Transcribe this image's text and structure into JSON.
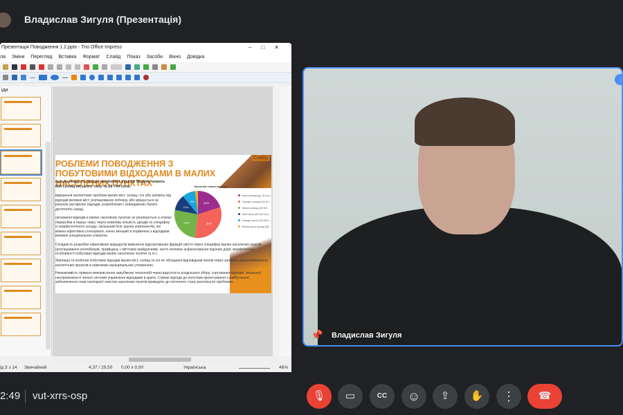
{
  "meeting": {
    "presenter_title": "Владислав Зигуля (Презентація)",
    "time": "2:49",
    "code": "vut-xrrs-osp"
  },
  "window": {
    "title": "Презентація Поводження 1.2.pptx - Trio Office Impress",
    "menu": [
      "ла",
      "Зміни",
      "Перегляд",
      "Вставка",
      "Формат",
      "Слайд",
      "Показ",
      "Засоби",
      "Вікно",
      "Довідка"
    ],
    "panel_label": "іди"
  },
  "slide": {
    "title": "РОБЛЕМИ ПОВОДЖЕННЯ З ПОБУТОВИМИ ВІДХОДАМИ В МАЛИХ НАСЕЛЕНИХ ПУНКТАХ",
    "badge": "Слайд",
    "intro": "гальна кількість малих населених пунктів України новить 896 селищ міського типу та 28 794 села.",
    "p1": "вирішення екологічних проблем малих міст, селищ і сіл або алежить від відходів великих міст, розташованих поблизу, або ирішується за рахунок застарілих підходів, розроблених і атверджених багато десятиліть назад.",
    "p2": "ортування відходів в малих населених пунктах не реалізується а етапах переробки в першу чергу через невелику кількість ідходів та специфіку їх морфологічного складу: загальний бсяг цінних компонентів, які можна ефективно утилізувати, начно менший в порівнянні з відходами великих униципальних утворень.",
    "p3": "Складність розробки ефективних маршрутів вивезення відсортованих фракцій сміття через специфіку малих населених пунктів (розташування контейнерів, приміщень і сміттєвих майданчиків, часто неповне асфальтування підїзних доріг, морфологічні особливості побутових відходів малих населених пунктів та ін.).",
    "p4": "Звалища та полігони побутових відходів малих міст, селищ та сіл не обладнані відповідним чином через загальну нерентабельність екологічних проєктів в невеликих муніципальних утвореннях.",
    "p5": "Неможливість прямого використання зарубіжних технологій через відсутність роздільного збору, сортування відходів, загальної неспроможності чинної системи управління відходами в країні. Стрімкі підходи до логістики проектування з майбутнього забезпечення схем санітарної очистки населених пунктів приводять до поточного стану розглянутої проблеми."
  },
  "chart_data": {
    "type": "pie",
    "title": "Частка міст кожної категорії",
    "categories": [
      "Малі селища (до 10 тис.)",
      "Середні селища (10-20 т",
      "Великі селища (20-50 т",
      "Малі міста (50-100 тис.)",
      "Середні міста (100-500 т",
      "Великі міста (понад 500"
    ],
    "values": [
      20,
      32,
      26,
      11,
      9,
      2
    ],
    "colors": [
      "#9b2d8e",
      "#f4645a",
      "#73b34a",
      "#1a3d7c",
      "#1aa5e0",
      "#f4a623"
    ]
  },
  "status": {
    "slide": "ід 3 з 14",
    "layout": "Звичайний",
    "position": "4,37 / 29,50",
    "size": "0,00 x 0,00",
    "language": "Українська",
    "zoom": "46%"
  },
  "participant": {
    "name": "Владислав Зигуля"
  },
  "controls": [
    {
      "name": "mic-off",
      "glyph": "🎙"
    },
    {
      "name": "camera",
      "glyph": "▭"
    },
    {
      "name": "captions",
      "glyph": "CC"
    },
    {
      "name": "emoji",
      "glyph": "☺"
    },
    {
      "name": "present",
      "glyph": "⇪"
    },
    {
      "name": "raise-hand",
      "glyph": "✋"
    },
    {
      "name": "more",
      "glyph": "⋮"
    },
    {
      "name": "leave",
      "glyph": "☎"
    }
  ],
  "colors": {
    "accent": "#4c8bf5",
    "danger": "#ea4335",
    "bg": "#202124"
  }
}
